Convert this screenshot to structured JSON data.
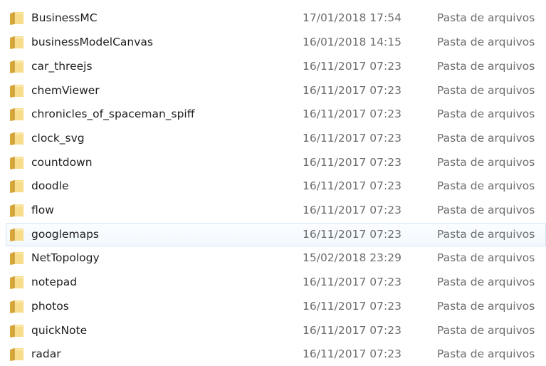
{
  "files": [
    {
      "name": "BusinessMC",
      "date": "17/01/2018 17:54",
      "type": "Pasta de arquivos",
      "icon": "folder-icon"
    },
    {
      "name": "businessModelCanvas",
      "date": "16/01/2018 14:15",
      "type": "Pasta de arquivos",
      "icon": "folder-icon"
    },
    {
      "name": "car_threejs",
      "date": "16/11/2017 07:23",
      "type": "Pasta de arquivos",
      "icon": "folder-icon"
    },
    {
      "name": "chemViewer",
      "date": "16/11/2017 07:23",
      "type": "Pasta de arquivos",
      "icon": "folder-icon"
    },
    {
      "name": "chronicles_of_spaceman_spiff",
      "date": "16/11/2017 07:23",
      "type": "Pasta de arquivos",
      "icon": "folder-icon"
    },
    {
      "name": "clock_svg",
      "date": "16/11/2017 07:23",
      "type": "Pasta de arquivos",
      "icon": "folder-icon"
    },
    {
      "name": "countdown",
      "date": "16/11/2017 07:23",
      "type": "Pasta de arquivos",
      "icon": "folder-icon"
    },
    {
      "name": "doodle",
      "date": "16/11/2017 07:23",
      "type": "Pasta de arquivos",
      "icon": "folder-icon"
    },
    {
      "name": "flow",
      "date": "16/11/2017 07:23",
      "type": "Pasta de arquivos",
      "icon": "folder-icon"
    },
    {
      "name": "googlemaps",
      "date": "16/11/2017 07:23",
      "type": "Pasta de arquivos",
      "icon": "folder-icon"
    },
    {
      "name": "NetTopology",
      "date": "15/02/2018 23:29",
      "type": "Pasta de arquivos",
      "icon": "folder-icon"
    },
    {
      "name": "notepad",
      "date": "16/11/2017 07:23",
      "type": "Pasta de arquivos",
      "icon": "folder-icon"
    },
    {
      "name": "photos",
      "date": "16/11/2017 07:23",
      "type": "Pasta de arquivos",
      "icon": "folder-icon"
    },
    {
      "name": "quickNote",
      "date": "16/11/2017 07:23",
      "type": "Pasta de arquivos",
      "icon": "folder-icon"
    },
    {
      "name": "radar",
      "date": "16/11/2017 07:23",
      "type": "Pasta de arquivos",
      "icon": "folder-icon"
    }
  ],
  "hovered_item": "googlemaps",
  "colors": {
    "folder_light": "#f7dc8a",
    "folder_dark": "#d9a63a",
    "hover_border": "#d4e6f7"
  }
}
